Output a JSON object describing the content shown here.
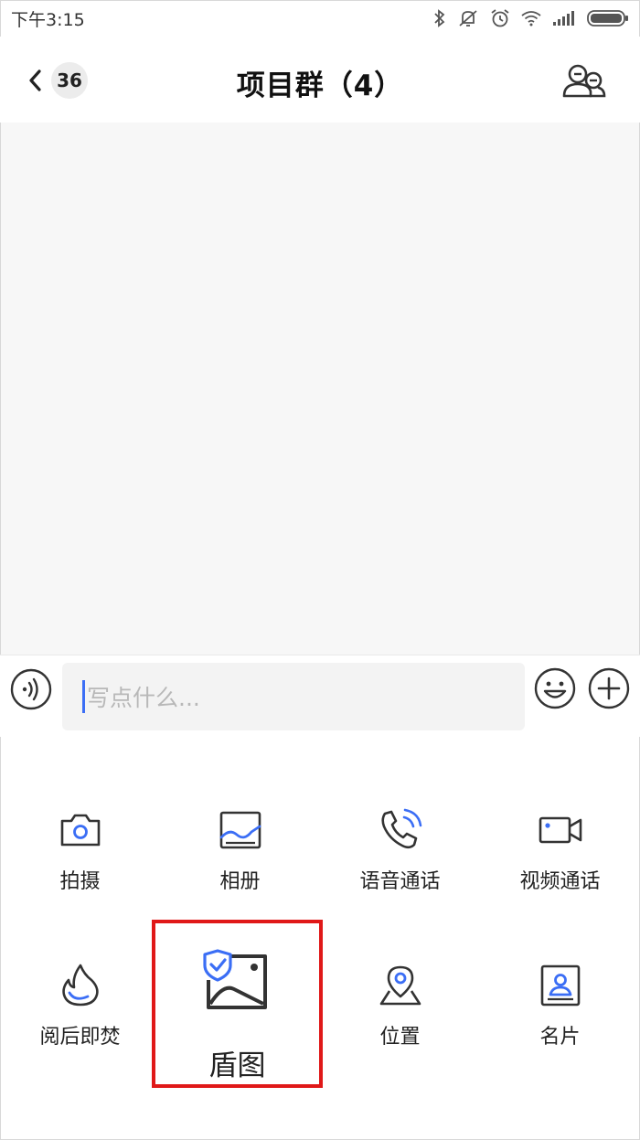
{
  "status": {
    "time": "下午3:15"
  },
  "header": {
    "unread_count": "36",
    "title": "项目群（4）"
  },
  "input": {
    "placeholder": "写点什么..."
  },
  "panel": {
    "items": [
      {
        "label": "拍摄",
        "icon": "camera-icon"
      },
      {
        "label": "相册",
        "icon": "album-icon"
      },
      {
        "label": "语音通话",
        "icon": "phone-call-icon"
      },
      {
        "label": "视频通话",
        "icon": "video-call-icon"
      },
      {
        "label": "阅后即焚",
        "icon": "flame-icon"
      },
      {
        "label": "盾图",
        "icon": "shield-image-icon"
      },
      {
        "label": "位置",
        "icon": "location-icon"
      },
      {
        "label": "名片",
        "icon": "contact-card-icon"
      }
    ]
  },
  "colors": {
    "accent": "#3b6ef5",
    "highlight_border": "#e01818",
    "chat_bg": "#f7f7f7"
  }
}
